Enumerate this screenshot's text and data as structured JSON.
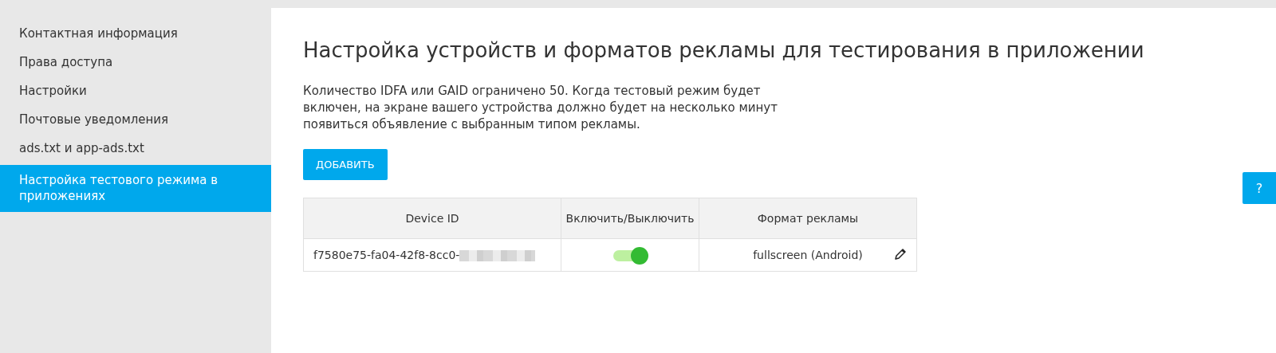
{
  "sidebar": {
    "items": [
      {
        "label": "Контактная информация",
        "selected": false
      },
      {
        "label": "Права доступа",
        "selected": false
      },
      {
        "label": "Настройки",
        "selected": false
      },
      {
        "label": "Почтовые уведомления",
        "selected": false
      },
      {
        "label": "ads.txt и app-ads.txt",
        "selected": false
      },
      {
        "label": "Настройка тестового режима в приложениях",
        "selected": true
      }
    ]
  },
  "main": {
    "title": "Настройка устройств и форматов рекламы для тестирования в приложении",
    "description": "Количество IDFA или GAID ограничено 50. Когда тестовый режим будет включен, на экране вашего устройства должно будет на несколько минут появиться объявление с выбранным типом рекламы.",
    "add_button": "ДОБАВИТЬ",
    "table": {
      "columns": [
        "Device ID",
        "Включить/Выключить",
        "Формат рекламы"
      ],
      "rows": [
        {
          "device_id": "f7580e75-fa04-42f8-8cc0-",
          "redacted": true,
          "on": true,
          "format": "fullscreen (Android)"
        }
      ]
    }
  },
  "help_button": "?"
}
